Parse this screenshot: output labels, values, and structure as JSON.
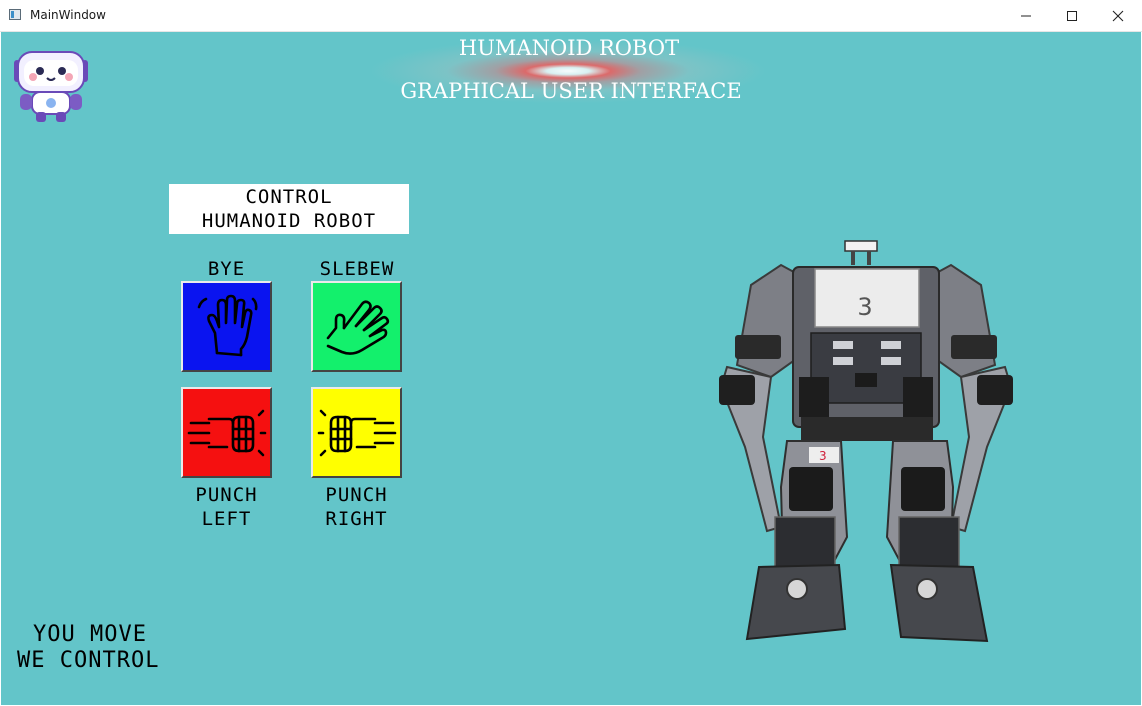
{
  "window": {
    "title": "MainWindow",
    "controls": [
      "minimize-icon",
      "maximize-icon",
      "close-icon"
    ]
  },
  "header": {
    "title_line1": "HUMANOID ROBOT",
    "title_line2": "GRAPHICAL USER INTERFACE"
  },
  "control_panel": {
    "title_line1": "CONTROL",
    "title_line2": "HUMANOID ROBOT"
  },
  "gestures": [
    {
      "label_top": "BYE",
      "icon": "waving-hand-icon",
      "color": "#0a14f0"
    },
    {
      "label_top": "SLEBEW",
      "icon": "slebew-hand-icon",
      "color": "#13f06c"
    },
    {
      "label_bottom_1": "PUNCH",
      "label_bottom_2": "LEFT",
      "icon": "fist-left-icon",
      "color": "#f51010"
    },
    {
      "label_bottom_1": "PUNCH",
      "label_bottom_2": "RIGHT",
      "icon": "fist-right-icon",
      "color": "#ffff00"
    }
  ],
  "robot_image": {
    "label": "3"
  },
  "motto": {
    "line1": "YOU MOVE",
    "line2": "WE CONTROL"
  },
  "colors": {
    "background": "#63c5c9",
    "title": "#ffffff"
  }
}
